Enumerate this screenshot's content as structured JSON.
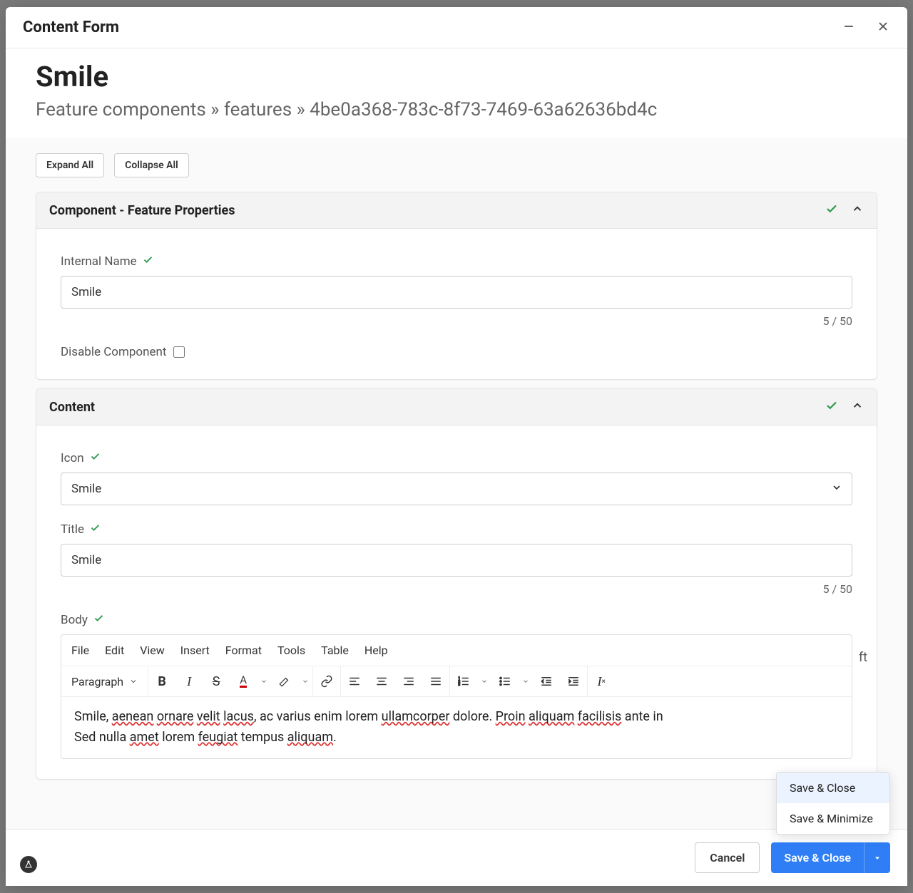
{
  "modal": {
    "title": "Content Form"
  },
  "page": {
    "title": "Smile",
    "breadcrumb": "Feature components » features » 4be0a368-783c-8f73-7469-63a62636bd4c"
  },
  "buttons": {
    "expand_all": "Expand All",
    "collapse_all": "Collapse All",
    "cancel": "Cancel",
    "save_close": "Save & Close"
  },
  "panels": {
    "properties": {
      "title": "Component - Feature Properties",
      "internal_name_label": "Internal Name",
      "internal_name_value": "Smile",
      "internal_name_counter": "5 / 50",
      "disable_label": "Disable Component",
      "disable_checked": false
    },
    "content": {
      "title": "Content",
      "icon_label": "Icon",
      "icon_value": "Smile",
      "title_label": "Title",
      "title_value": "Smile",
      "title_counter": "5 / 50",
      "body_label": "Body"
    }
  },
  "editor": {
    "menus": {
      "file": "File",
      "edit": "Edit",
      "view": "View",
      "insert": "Insert",
      "format": "Format",
      "tools": "Tools",
      "table": "Table",
      "help": "Help"
    },
    "block_format": "Paragraph",
    "content_segments": [
      {
        "t": "Smile, "
      },
      {
        "t": "aenean",
        "s": true
      },
      {
        "t": " "
      },
      {
        "t": "ornare",
        "s": true
      },
      {
        "t": " "
      },
      {
        "t": "velit",
        "s": true
      },
      {
        "t": " "
      },
      {
        "t": "lacus",
        "s": true
      },
      {
        "t": ", ac varius enim lorem "
      },
      {
        "t": "ullamcorper",
        "s": true
      },
      {
        "t": " dolore. "
      },
      {
        "t": "Proin",
        "s": true
      },
      {
        "t": " "
      },
      {
        "t": "aliquam",
        "s": true
      },
      {
        "t": " "
      },
      {
        "t": "facilisis",
        "s": true
      },
      {
        "t": " ante in"
      }
    ],
    "content_segments2": [
      {
        "t": "Sed nulla "
      },
      {
        "t": "amet",
        "s": true
      },
      {
        "t": " lorem "
      },
      {
        "t": "feugiat",
        "s": true
      },
      {
        "t": " tempus "
      },
      {
        "t": "aliquam",
        "s": true
      },
      {
        "t": "."
      }
    ]
  },
  "dropdown": {
    "save_close": "Save & Close",
    "save_minimize": "Save & Minimize"
  },
  "extra": {
    "ft": "ft"
  }
}
